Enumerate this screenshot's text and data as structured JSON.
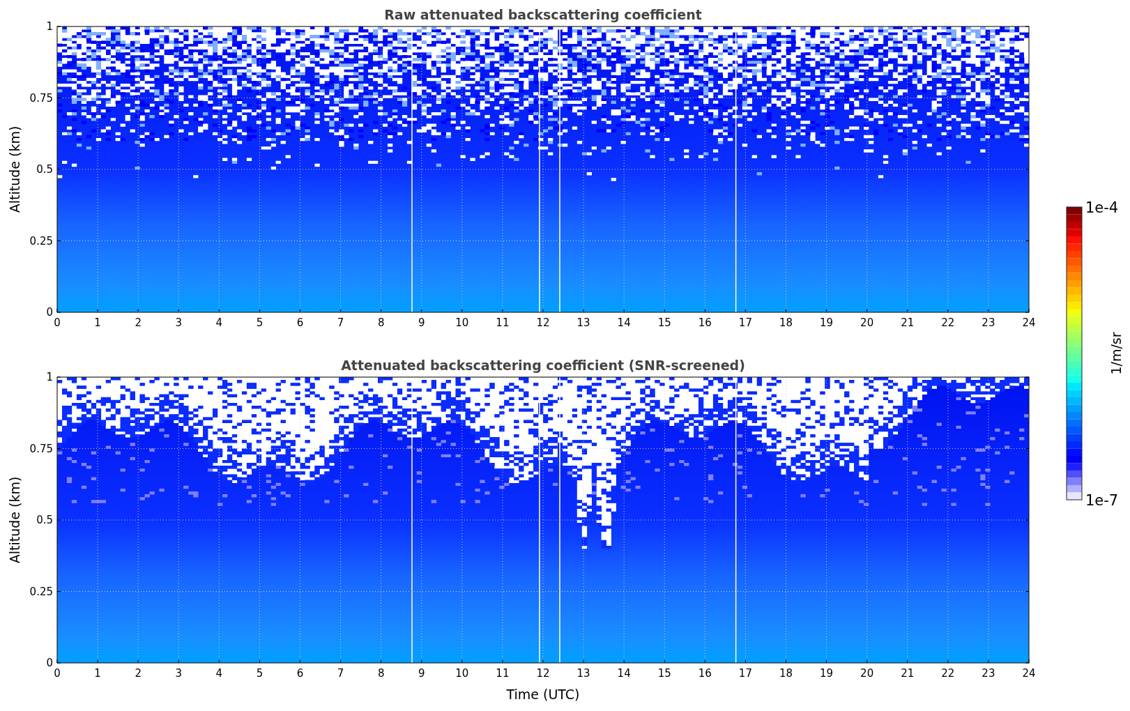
{
  "panels": [
    {
      "title": "Raw attenuated backscattering coefficient",
      "y_label": "Altitude (km)",
      "y_ticks": [
        "1",
        "0.75",
        "0.5",
        "0.25",
        "0"
      ],
      "x_ticks": [
        "0",
        "1",
        "2",
        "3",
        "4",
        "5",
        "6",
        "7",
        "8",
        "9",
        "10",
        "11",
        "12",
        "13",
        "14",
        "15",
        "16",
        "17",
        "18",
        "19",
        "20",
        "21",
        "22",
        "23",
        "24"
      ],
      "kind": "raw"
    },
    {
      "title": "Attenuated backscattering coefficient (SNR-screened)",
      "y_label": "Altitude (km)",
      "y_ticks": [
        "1",
        "0.75",
        "0.5",
        "0.25",
        "0"
      ],
      "x_ticks": [
        "0",
        "1",
        "2",
        "3",
        "4",
        "5",
        "6",
        "7",
        "8",
        "9",
        "10",
        "11",
        "12",
        "13",
        "14",
        "15",
        "16",
        "17",
        "18",
        "19",
        "20",
        "21",
        "22",
        "23",
        "24"
      ],
      "x_label": "Time (UTC)",
      "kind": "screened"
    }
  ],
  "colorbar": {
    "max_label": "1e-4",
    "min_label": "1e-7",
    "unit": "1/m/sr"
  }
}
